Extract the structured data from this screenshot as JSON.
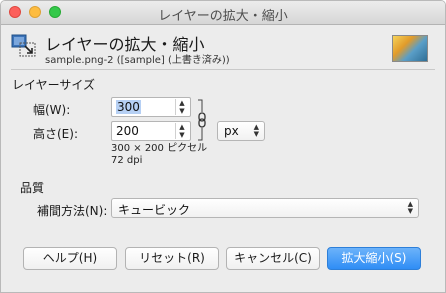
{
  "window": {
    "title": "レイヤーの拡大・縮小"
  },
  "header": {
    "title": "レイヤーの拡大・縮小",
    "subtitle": "sample.png-2 ([sample] (上書き済み))"
  },
  "layer_size": {
    "section_label": "レイヤーサイズ",
    "width_label": "幅(W):",
    "width_value": "300",
    "height_label": "高さ(E):",
    "height_value": "200",
    "unit": "px",
    "size_info": "300 × 200 ピクセル",
    "dpi_info": "72 dpi"
  },
  "quality": {
    "section_label": "品質",
    "interpolation_label": "補間方法(N):",
    "interpolation_value": "キュービック"
  },
  "buttons": {
    "help": "ヘルプ(H)",
    "reset": "リセット(R)",
    "cancel": "キャンセル(C)",
    "scale": "拡大縮小(S)"
  },
  "colors": {
    "primary_button": "#2f8df5",
    "selection": "#b6d0f4"
  }
}
